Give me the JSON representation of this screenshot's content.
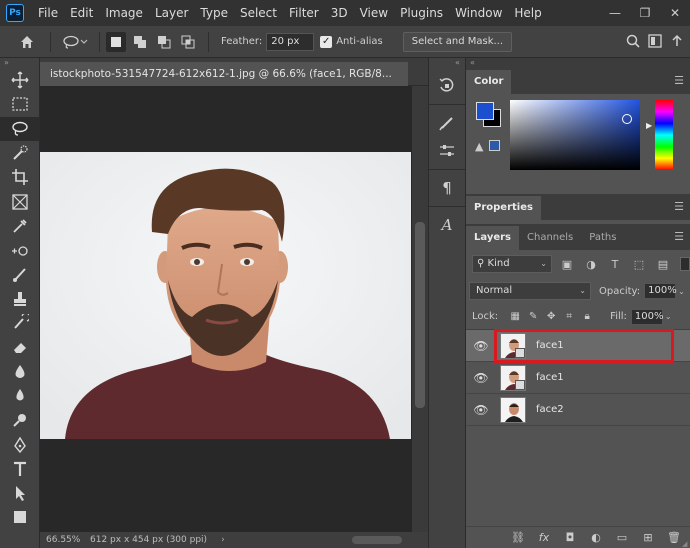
{
  "app": {
    "logo": "Ps"
  },
  "menu": [
    "File",
    "Edit",
    "Image",
    "Layer",
    "Type",
    "Select",
    "Filter",
    "3D",
    "View",
    "Plugins",
    "Window",
    "Help"
  ],
  "options": {
    "feather_label": "Feather:",
    "feather_value": "20 px",
    "antialias_label": "Anti-alias",
    "antialias_checked": true,
    "select_mask_label": "Select and Mask..."
  },
  "document": {
    "tab_title": "istockphoto-531547724-612x612-1.jpg @ 66.6% (face1, RGB/8...",
    "zoom": "66.55%",
    "dimensions": "612 px x 454 px (300 ppi)"
  },
  "panels": {
    "color": {
      "tab": "Color",
      "foreground": "#1a4fd0",
      "background": "#000000"
    },
    "properties": {
      "tab": "Properties"
    },
    "layers": {
      "tabs": [
        "Layers",
        "Channels",
        "Paths"
      ],
      "filter_kind": "Kind",
      "blend_mode": "Normal",
      "opacity_label": "Opacity:",
      "opacity_value": "100%",
      "lock_label": "Lock:",
      "fill_label": "Fill:",
      "fill_value": "100%",
      "items": [
        {
          "name": "face1",
          "visible": true,
          "selected": true
        },
        {
          "name": "face1",
          "visible": true,
          "selected": false
        },
        {
          "name": "face2",
          "visible": true,
          "selected": false
        }
      ]
    }
  },
  "colors": {
    "highlight_outline": "#d8191f",
    "accent": "#31a8ff"
  }
}
